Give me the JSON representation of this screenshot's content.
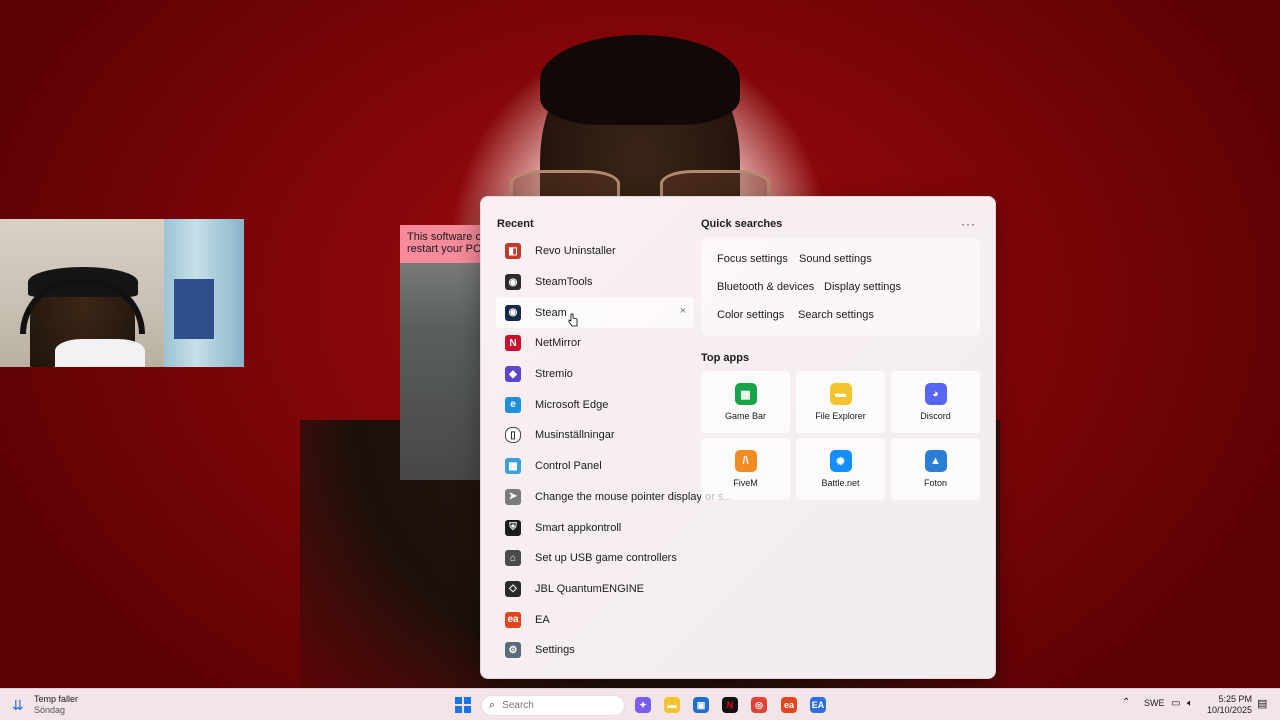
{
  "flyout": {
    "recent_label": "Recent",
    "recent": [
      {
        "label": "Revo Uninstaller",
        "icon": "revo-uninstaller-icon",
        "color": "#c0392b"
      },
      {
        "label": "SteamTools",
        "icon": "steamtools-icon",
        "color": "#2b2b2b"
      },
      {
        "label": "Steam",
        "icon": "steam-icon",
        "color": "#16294a"
      },
      {
        "label": "NetMirror",
        "icon": "netmirror-icon",
        "color": "#c8102e"
      },
      {
        "label": "Stremio",
        "icon": "stremio-icon",
        "color": "#5b47c9"
      },
      {
        "label": "Microsoft Edge",
        "icon": "edge-icon",
        "color": "#1f8fdc"
      },
      {
        "label": "Musinställningar",
        "icon": "mouse-icon",
        "color": "#ffffff"
      },
      {
        "label": "Control Panel",
        "icon": "control-panel-icon",
        "color": "#3aa0d8"
      },
      {
        "label": "Change the mouse pointer display or s...",
        "icon": "mouse-pointer-icon",
        "color": "#7a7a7a"
      },
      {
        "label": "Smart appkontroll",
        "icon": "shield-icon",
        "color": "#1c1c1c"
      },
      {
        "label": "Set up USB game controllers",
        "icon": "gamepad-icon",
        "color": "#4a4a4a"
      },
      {
        "label": "JBL QuantumENGINE",
        "icon": "jbl-icon",
        "color": "#2b2b2b"
      },
      {
        "label": "EA",
        "icon": "ea-icon",
        "color": "#e2451c"
      },
      {
        "label": "Settings",
        "icon": "gear-icon",
        "color": "#5b6b7a"
      }
    ],
    "quick_label": "Quick searches",
    "more_label": "···",
    "quick": [
      "Focus settings",
      "Sound settings",
      "Bluetooth & devices",
      "Display settings",
      "Color settings",
      "Search settings"
    ],
    "top_apps_label": "Top apps",
    "top_apps": [
      {
        "label": "Game Bar",
        "icon": "game-bar-icon",
        "color": "#16a34a"
      },
      {
        "label": "File Explorer",
        "icon": "folder-icon",
        "color": "#f4c430"
      },
      {
        "label": "Discord",
        "icon": "discord-icon",
        "color": "#5865f2"
      },
      {
        "label": "FiveM",
        "icon": "fivem-icon",
        "color": "#f28b21"
      },
      {
        "label": "Battle.net",
        "icon": "battlenet-icon",
        "color": "#148eff"
      },
      {
        "label": "Foton",
        "icon": "photos-icon",
        "color": "#2a7fd4"
      }
    ]
  },
  "bg_app": {
    "banner_line1": "This software ca",
    "banner_line2": "restart your PC."
  },
  "taskbar": {
    "weather_title": "Temp faller",
    "weather_sub": "Söndag",
    "search_placeholder": "Search",
    "apps": [
      {
        "icon": "copilot-icon",
        "color": "#7a5cf0"
      },
      {
        "icon": "file-explorer-icon",
        "color": "#f4c430"
      },
      {
        "icon": "microsoft-store-icon",
        "color": "#1f6fd1"
      },
      {
        "icon": "netflix-icon",
        "color": "#111111"
      },
      {
        "icon": "chrome-icon",
        "color": "#e34133"
      },
      {
        "icon": "ea-app-icon",
        "color": "#e2451c"
      },
      {
        "icon": "ea-desktop-icon",
        "color": "#2f6fe4"
      }
    ],
    "language": "SWE",
    "time": "5:25 PM",
    "date": "10/10/2025"
  }
}
